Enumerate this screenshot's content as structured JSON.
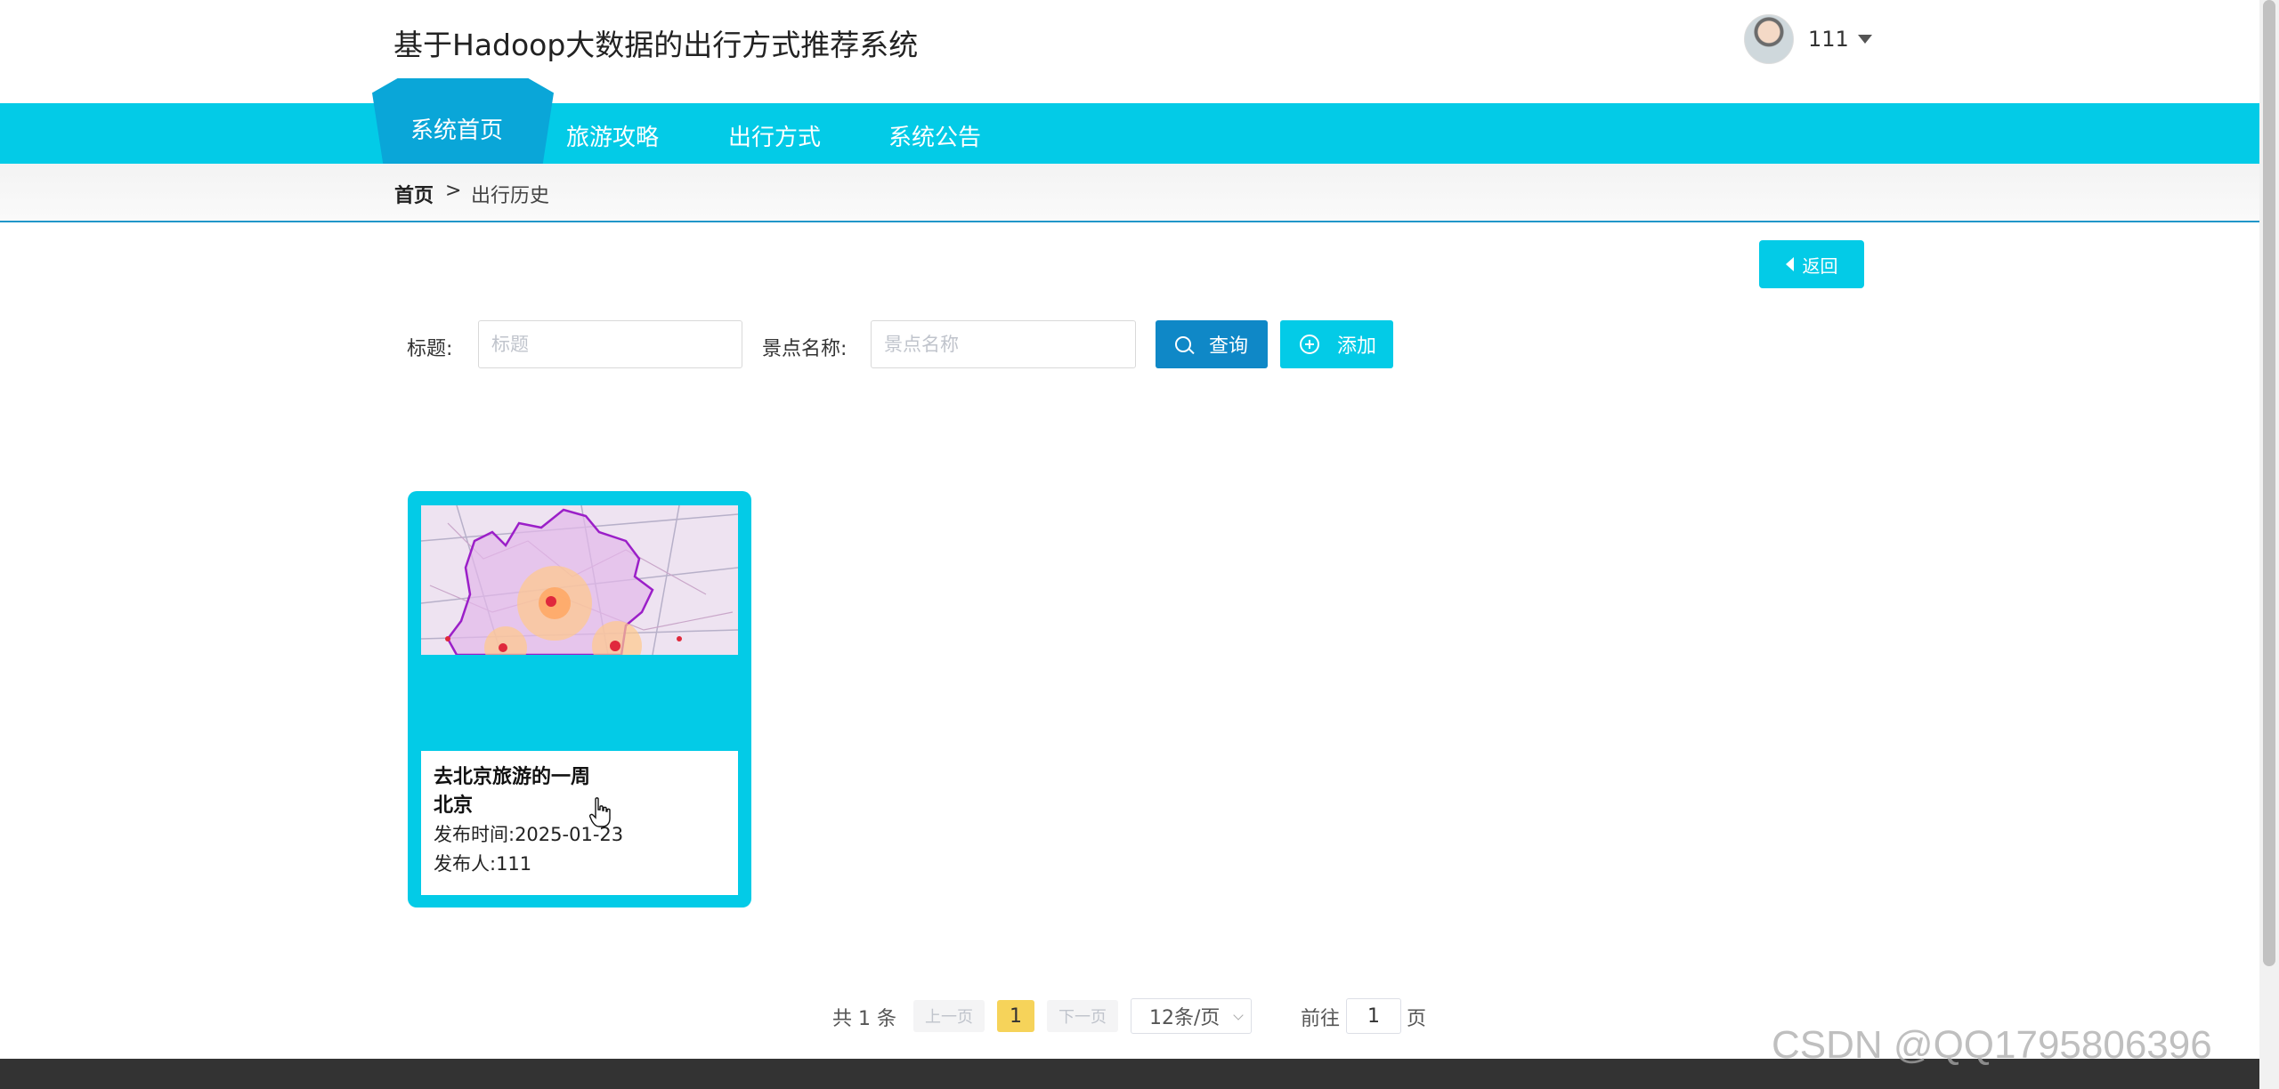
{
  "header": {
    "site_title": "基于Hadoop大数据的出行方式推荐系统",
    "user_name": "111"
  },
  "nav": {
    "items": [
      {
        "label": "系统首页",
        "active": true
      },
      {
        "label": "旅游攻略",
        "active": false
      },
      {
        "label": "出行方式",
        "active": false
      },
      {
        "label": "系统公告",
        "active": false
      }
    ]
  },
  "breadcrumb": {
    "home": "首页",
    "separator": ">",
    "current": "出行历史"
  },
  "back_button": "返回",
  "search": {
    "title_label": "标题:",
    "title_placeholder": "标题",
    "spot_label": "景点名称:",
    "spot_placeholder": "景点名称",
    "query_button": "查询",
    "add_button": "添加"
  },
  "cards": [
    {
      "title": "去北京旅游的一周",
      "place": "北京",
      "publish_time": "发布时间:2025-01-23",
      "publisher": "发布人:111"
    }
  ],
  "pagination": {
    "total": "共 1 条",
    "prev": "上一页",
    "current_page": "1",
    "next": "下一页",
    "page_size": "12条/页",
    "goto_label": "前往",
    "goto_value": "1",
    "page_suffix": "页"
  },
  "watermark": "CSDN @QQ1795806396",
  "colors": {
    "accent": "#03cbe7",
    "active_tab": "#0aa6d8",
    "query_button": "#0f88c7",
    "current_page": "#f6d35a",
    "footer": "#333333"
  }
}
